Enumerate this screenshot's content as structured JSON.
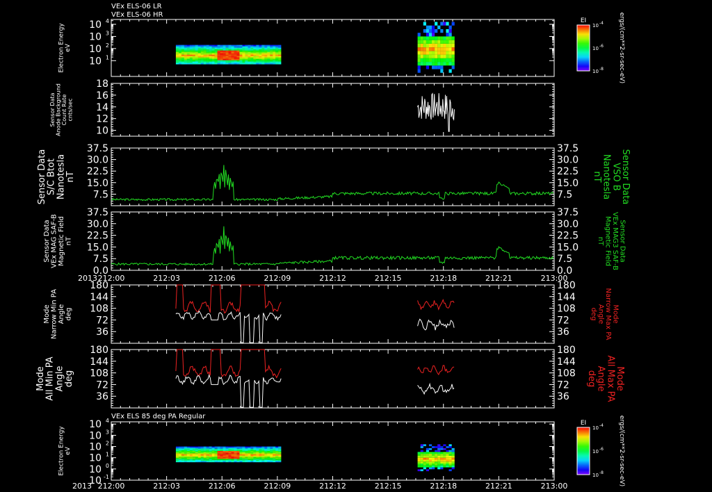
{
  "colors": {
    "background": "#000000",
    "axis": "#ffffff",
    "green": "#22dd22",
    "red": "#ee2222",
    "white": "#ffffff"
  },
  "header": {
    "line1": "VEx ELS-06 LR",
    "line2": "VEx ELS-06 HR"
  },
  "time_axis": {
    "year": "2013",
    "ticks": [
      "212:00",
      "212:03",
      "212:06",
      "212:09",
      "212:12",
      "212:15",
      "212:18",
      "212:21",
      "213:00"
    ],
    "tick_values_min": [
      0,
      3,
      6,
      9,
      12,
      15,
      18,
      21,
      24
    ]
  },
  "chart_data": [
    {
      "type": "heatmap",
      "id": "spec1",
      "left_label": [
        "Electron Energy",
        "eV"
      ],
      "yticks": [
        {
          "base": "10",
          "exp": "4",
          "v": 4
        },
        {
          "base": "10",
          "exp": "3",
          "v": 3
        },
        {
          "base": "10",
          "exp": "2",
          "v": 2
        },
        {
          "base": "10",
          "exp": "1",
          "v": 1
        }
      ],
      "ylim_log10": [
        -0.3,
        4.4
      ],
      "colorbar": {
        "title": "EI",
        "ticks": [
          {
            "base": "10",
            "exp": "-4",
            "pos": 0
          },
          {
            "base": "10",
            "exp": "-6",
            "pos": 0.5
          },
          {
            "base": "10",
            "exp": "-8",
            "pos": 1
          }
        ],
        "units": "ergs/(cm**2-sr-sec-eV)"
      },
      "blocks": [
        {
          "x": [
            3.5,
            9.2
          ],
          "y_log10": [
            0.7,
            2.3
          ]
        },
        {
          "x": [
            16.6,
            18.6
          ],
          "y_log10": [
            0.0,
            4.2
          ]
        }
      ]
    },
    {
      "type": "line",
      "id": "count",
      "left_label": [
        "Sensor Data",
        "Anode Background",
        "Count Rate",
        "cnts/sec"
      ],
      "yticks": [
        10,
        12,
        14,
        16,
        18
      ],
      "ylim": [
        9,
        18
      ],
      "series": [
        {
          "color": "white",
          "x_range": [
            16.6,
            18.6
          ],
          "y_mean": 14.0,
          "y_amp": 2.4
        }
      ]
    },
    {
      "type": "line",
      "id": "btot",
      "left_label": [
        "Sensor Data",
        "S/C Btot",
        "Nanotesla",
        "nT"
      ],
      "right_label": [
        "Sensor Data",
        "VSO B",
        "Nanotesla",
        "nT"
      ],
      "yticks": [
        7.5,
        15.0,
        22.5,
        30.0,
        37.5
      ],
      "ylim": [
        0,
        37.5
      ],
      "series": [
        {
          "color": "green"
        }
      ]
    },
    {
      "type": "line",
      "id": "bmag",
      "left_label": [
        "Sensor Data",
        "VEx MAG SAF-B",
        "Magnetic Field",
        "nT"
      ],
      "right_label": [
        "Sensor Data",
        "VEx MAG3 SAF-B",
        "Magnetic Field",
        "nT"
      ],
      "yticks": [
        0.0,
        7.5,
        15.0,
        22.5,
        30.0,
        37.5
      ],
      "ylim": [
        0,
        37.5
      ],
      "series": [
        {
          "color": "green"
        }
      ]
    },
    {
      "type": "line",
      "id": "npa",
      "left_label": [
        "Mode",
        "Narrow Min PA",
        "Angle",
        "deg"
      ],
      "right_label": [
        "Mode",
        "Narrow Max PA",
        "Angle",
        "deg"
      ],
      "yticks": [
        36,
        72,
        108,
        144,
        180
      ],
      "ylim": [
        0,
        180
      ],
      "series": [
        {
          "color": "red"
        },
        {
          "color": "white"
        }
      ]
    },
    {
      "type": "line",
      "id": "apa",
      "left_label": [
        "Mode",
        "All Min PA",
        "Angle",
        "deg"
      ],
      "right_label": [
        "Mode",
        "All Max PA",
        "Angle",
        "deg"
      ],
      "yticks": [
        36,
        72,
        108,
        144,
        180
      ],
      "ylim": [
        0,
        180
      ],
      "series": [
        {
          "color": "red"
        },
        {
          "color": "white"
        }
      ]
    },
    {
      "type": "heatmap",
      "id": "spec2",
      "title": "VEx ELS 85 deg PA Regular",
      "left_label": [
        "Electron Energy",
        "eV"
      ],
      "yticks": [
        {
          "base": "10",
          "exp": "4",
          "v": 4
        },
        {
          "base": "10",
          "exp": "3",
          "v": 3
        },
        {
          "base": "10",
          "exp": "2",
          "v": 2
        },
        {
          "base": "10",
          "exp": "1",
          "v": 1
        },
        {
          "base": "10",
          "exp": "0",
          "v": 0
        },
        {
          "base": "10",
          "exp": "-1",
          "v": -1
        }
      ],
      "ylim_log10": [
        -1,
        4.2
      ],
      "colorbar": {
        "title": "EI",
        "ticks": [
          {
            "base": "10",
            "exp": "-4",
            "pos": 0
          },
          {
            "base": "10",
            "exp": "-6",
            "pos": 0.5
          },
          {
            "base": "10",
            "exp": "-8",
            "pos": 1
          }
        ],
        "units": "ergs/(cm**2-sr-sec-eV)"
      },
      "blocks": [
        {
          "x": [
            3.5,
            9.2
          ],
          "y_log10": [
            0.6,
            2.0
          ]
        },
        {
          "x": [
            16.6,
            18.6
          ],
          "y_log10": [
            -0.2,
            2.2
          ]
        }
      ]
    }
  ]
}
